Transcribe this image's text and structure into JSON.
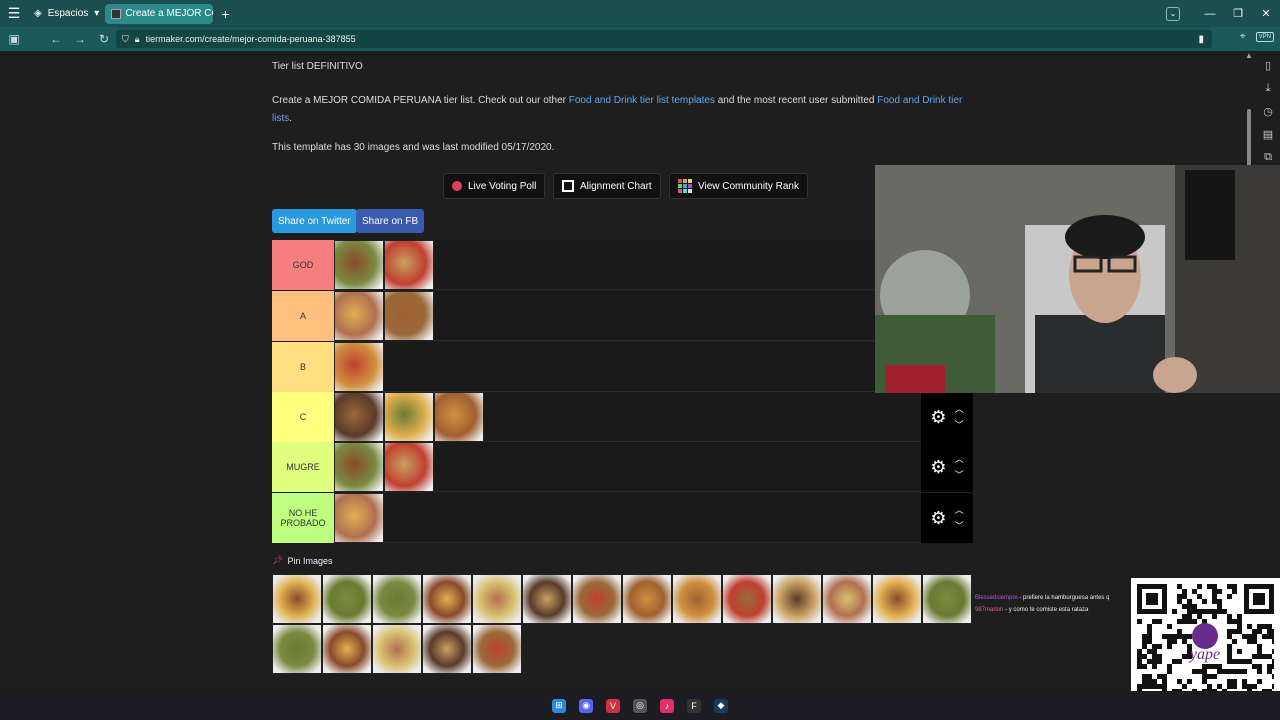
{
  "browser": {
    "spaces_label": "Espacios",
    "tab_title": "Create a MEJOR COMIDA P",
    "url": "tiermaker.com/create/mejor-comida-peruana-387855",
    "vpn_label": "VPN"
  },
  "page": {
    "subtitle": "Tier list DEFINITIVO",
    "intro_1": "Create a MEJOR COMIDA PERUANA tier list. Check out our other",
    "intro_link_1": "Food and Drink tier list templates",
    "intro_2": "and the most recent user submitted",
    "intro_link_2": "Food and Drink tier lists",
    "intro_3": ".",
    "meta": "This template has 30 images and was last modified 05/17/2020.",
    "actions": {
      "live_voting": "Live Voting Poll",
      "alignment": "Alignment Chart",
      "community": "View Community Rank"
    },
    "share_twitter": "Share on Twitter",
    "share_fb": "Share on FB",
    "pin_label": "Pin Images"
  },
  "tiers": [
    {
      "label": "GOD",
      "color": "#f57f7f",
      "count": 2
    },
    {
      "label": "A",
      "color": "#ffbf7f",
      "count": 2
    },
    {
      "label": "B",
      "color": "#ffdf7f",
      "count": 1
    },
    {
      "label": "C",
      "color": "#ffff7f",
      "count": 3
    },
    {
      "label": "MUGRE",
      "color": "#dfff7f",
      "count": 2
    },
    {
      "label": "NO HE PROBADO",
      "color": "#bfff7f",
      "count": 1
    }
  ],
  "pool_count": 19,
  "chat": [
    {
      "user": "Blessedsiempre",
      "message": "- prefiere la hamburguesa antes q"
    },
    {
      "user": "987marlon",
      "message": "- y como te comiste esta rataza"
    }
  ],
  "qr_label": "yape"
}
